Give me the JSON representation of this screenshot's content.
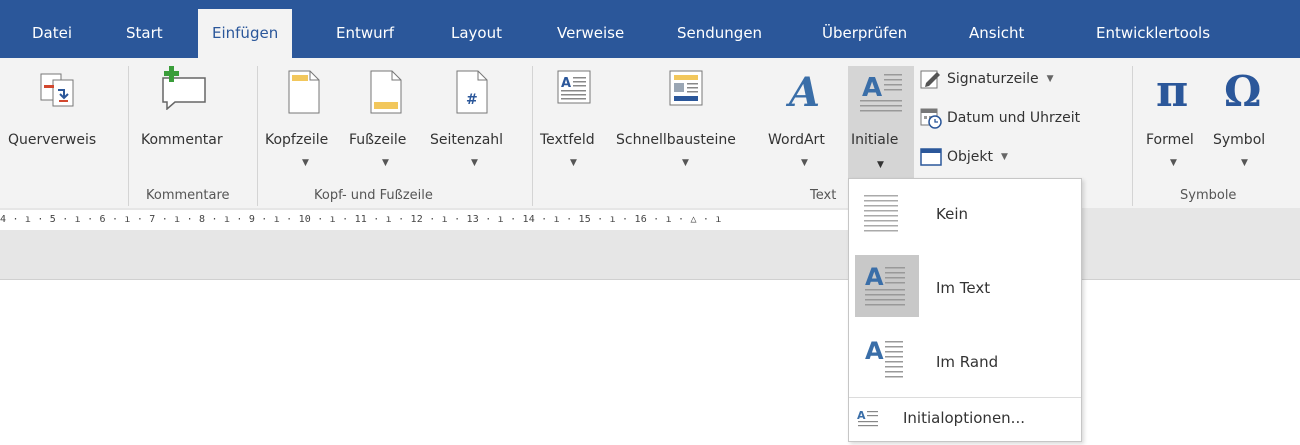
{
  "tabs": [
    "Datei",
    "Start",
    "Einfügen",
    "Entwurf",
    "Layout",
    "Verweise",
    "Sendungen",
    "Überprüfen",
    "Ansicht",
    "Entwicklertools"
  ],
  "active_tab": "Einfügen",
  "buttons": {
    "querverweis": "Querverweis",
    "kommentar": "Kommentar",
    "kopfzeile": "Kopfzeile",
    "fusszeile": "Fußzeile",
    "seitenzahl": "Seitenzahl",
    "textfeld": "Textfeld",
    "schnellbausteine": "Schnellbausteine",
    "wordart": "WordArt",
    "initiale": "Initiale",
    "signaturzeile": "Signaturzeile",
    "datum_uhrzeit": "Datum und Uhrzeit",
    "objekt": "Objekt",
    "formel": "Formel",
    "symbol": "Symbol"
  },
  "groups": {
    "kommentare": "Kommentare",
    "kopf_fusszeile": "Kopf- und Fußzeile",
    "text": "Text",
    "symbole": "Symbole"
  },
  "ruler": "4 · ı · 5 · ı · 6 · ı · 7 · ı · 8 · ı · 9 · ı · 10 · ı · 11 · ı · 12 · ı · 13 · ı · 14 · ı · 15 · ı · 16 · ı · △ · ı",
  "dropdown": {
    "items": [
      "Kein",
      "Im Text",
      "Im Rand"
    ],
    "selected": "Im Text",
    "options": "Initialoptionen..."
  },
  "colors": {
    "tabbar": "#2b579a",
    "ribbon": "#f3f3f3",
    "accent_blue": "#3a6ea8"
  }
}
